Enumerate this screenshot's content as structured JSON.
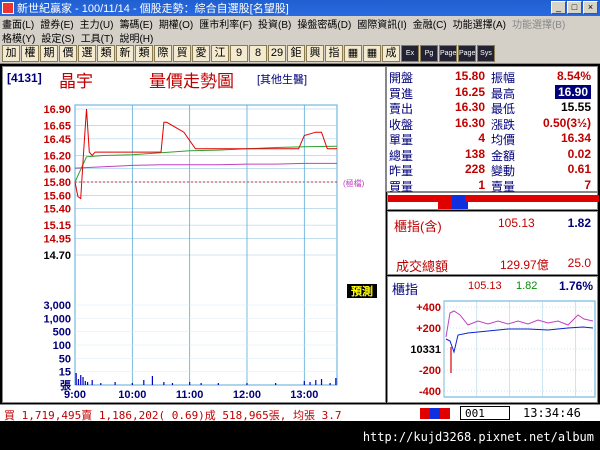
{
  "window": {
    "title": "新世紀贏家 - 100/11/14 - 個股走勢：綜合自選股[名望股]",
    "controls": [
      "_",
      "□",
      "×"
    ]
  },
  "menu1": [
    "畫面(L)",
    "證券(E)",
    "主力(U)",
    "籌碼(E)",
    "期權(O)",
    "匯市利率(F)",
    "投資(B)",
    "操盤密碼(D)",
    "國際資訊(I)",
    "金融(C)",
    "功能選擇(A)",
    "功能選擇(B)"
  ],
  "menu2": [
    "格模(Y)",
    "設定(S)",
    "工具(T)",
    "說明(H)"
  ],
  "toolbar": [
    "加",
    "權",
    "期",
    "價",
    "選",
    "類",
    "新",
    "類",
    "際",
    "貿",
    "愛",
    "江",
    "9",
    "8",
    "29",
    "鉅",
    "興",
    "指",
    "▦",
    "▦",
    "成",
    "Ex",
    "Pg",
    "Page",
    "Page",
    "Sys"
  ],
  "stock": {
    "code": "[4131]",
    "name": "晶宇",
    "chart_title": "量價走勢圖",
    "indicator": "[其他生醫]",
    "limit_marker": "(極檔)",
    "limit_up_tag": "預測"
  },
  "quote": {
    "rows": [
      {
        "l1": "開盤",
        "v1": "15.80",
        "l2": "振幅",
        "v2": "8.54%"
      },
      {
        "l1": "買進",
        "v1": "16.25",
        "l2": "最高",
        "v2": "16.90"
      },
      {
        "l1": "賣出",
        "v1": "16.30",
        "l2": "最低",
        "v2": "15.55"
      },
      {
        "l1": "收盤",
        "v1": "16.30",
        "l2": "漲跌",
        "v2": "0.50(3½)"
      },
      {
        "l1": "單量",
        "v1": "4",
        "l2": "均價",
        "v2": "16.34"
      },
      {
        "l1": "總量",
        "v1": "138",
        "l2": "金額",
        "v2": "0.02"
      },
      {
        "l1": "昨量",
        "v1": "228",
        "l2": "變動",
        "v2": "0.61"
      },
      {
        "l1": "買量",
        "v1": "1",
        "l2": "賣量",
        "v2": "7"
      }
    ]
  },
  "index_summary": {
    "label": "櫃指(含)",
    "value": "105.13",
    "change": "1.82",
    "turnover_label": "成交總額",
    "turnover": "129.97億",
    "volume": "25.0"
  },
  "mini_index": {
    "label": "櫃指",
    "value": "105.13",
    "change": "1.82",
    "pct": "1.76%",
    "y_ticks": [
      "+400",
      "+200",
      "10331",
      "-200",
      "-400"
    ]
  },
  "status": {
    "text": "買 1,719,495賣 1,186,202( 0.69)成 518,965張, 均張 3.7",
    "box": "001",
    "time": "13:34:46"
  },
  "footer": {
    "url": "http://kujd3268.pixnet.net/album"
  },
  "chart_data": {
    "type": "line",
    "title": "量價走勢圖",
    "price_ticks": [
      "16.90",
      "16.65",
      "16.45",
      "16.20",
      "16.00",
      "15.80",
      "15.60",
      "15.40",
      "15.15",
      "14.95",
      "14.70"
    ],
    "volume_ticks": [
      "3,000",
      "1,000",
      "500",
      "100",
      "50",
      "15",
      "張"
    ],
    "time_ticks": [
      "9:00",
      "10:00",
      "11:00",
      "12:00",
      "13:00"
    ],
    "ylim": [
      14.7,
      16.9
    ],
    "series": [
      {
        "name": "",
        "color": "#e00000",
        "x": [
          9.0,
          9.05,
          9.1,
          9.15,
          9.2,
          9.25,
          9.3,
          9.35,
          9.5,
          9.8,
          10.0,
          10.2,
          10.4,
          10.5,
          10.55,
          10.6,
          10.9,
          11.1,
          11.2,
          11.5,
          11.8,
          12.0,
          12.3,
          12.6,
          12.9,
          13.0,
          13.2,
          13.3,
          13.4,
          13.5,
          13.57
        ],
        "y": [
          15.8,
          15.58,
          15.55,
          16.25,
          16.9,
          16.25,
          16.2,
          16.25,
          16.25,
          16.25,
          16.25,
          16.25,
          16.25,
          16.25,
          16.7,
          16.7,
          16.55,
          16.3,
          16.3,
          16.3,
          16.3,
          16.3,
          16.3,
          16.3,
          16.3,
          16.5,
          16.55,
          16.55,
          16.3,
          16.3,
          16.3
        ]
      },
      {
        "name": "",
        "color": "#30a030",
        "x": [
          9.0,
          9.2,
          9.5,
          10.0,
          10.5,
          11.0,
          11.5,
          12.0,
          12.5,
          13.0,
          13.57
        ],
        "y": [
          15.8,
          16.18,
          16.2,
          16.21,
          16.24,
          16.27,
          16.28,
          16.3,
          16.32,
          16.33,
          16.34
        ]
      },
      {
        "name": "",
        "color": "#c040c0",
        "x": [
          9.0,
          9.5,
          10.0,
          10.5,
          11.0,
          11.5,
          12.0,
          12.5,
          13.0,
          13.57
        ],
        "y": [
          16.01,
          16.03,
          16.05,
          16.06,
          16.06,
          16.06,
          16.07,
          16.07,
          16.08,
          16.08
        ]
      }
    ],
    "volume": {
      "x": [
        9.02,
        9.06,
        9.1,
        9.14,
        9.18,
        9.22,
        9.3,
        9.45,
        9.7,
        10.0,
        10.2,
        10.35,
        10.55,
        10.7,
        11.0,
        11.2,
        11.5,
        12.0,
        12.5,
        13.0,
        13.1,
        13.2,
        13.3,
        13.45,
        13.55
      ],
      "y": [
        12,
        6,
        10,
        8,
        4,
        3,
        5,
        2,
        3,
        2,
        5,
        9,
        3,
        2,
        3,
        2,
        2,
        2,
        2,
        4,
        3,
        5,
        6,
        2,
        7
      ]
    }
  }
}
